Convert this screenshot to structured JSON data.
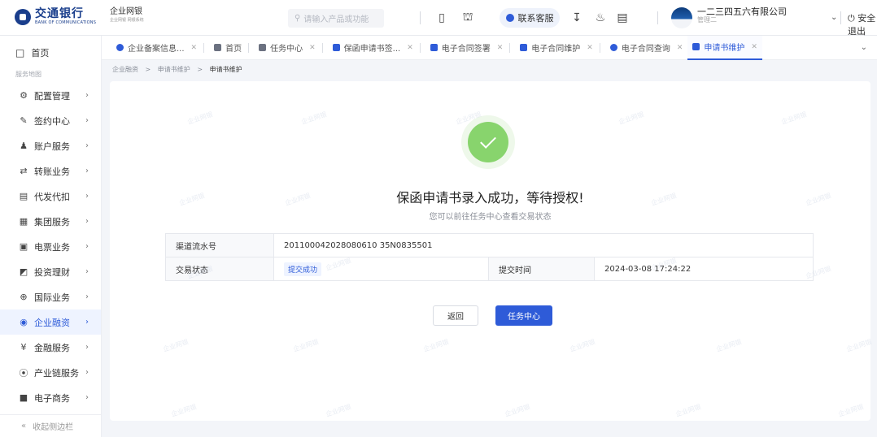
{
  "header": {
    "logo_cn": "交通银行",
    "logo_en": "BANK OF COMMUNICATIONS",
    "brand_cn": "企业网银",
    "brand_en": "企业网银 网银系统",
    "search_placeholder": "请输入产品或功能",
    "service_label": "联系客服",
    "company_name": "一二三四五六有限公司",
    "company_sub": "管理二",
    "logout_label": "安全退出"
  },
  "sidebar": {
    "home_label": "首页",
    "section_title": "服务地图",
    "items": [
      {
        "label": "配置管理",
        "icon": "settings-icon"
      },
      {
        "label": "签约中心",
        "icon": "pen-icon"
      },
      {
        "label": "账户服务",
        "icon": "user-icon"
      },
      {
        "label": "转账业务",
        "icon": "transfer-icon"
      },
      {
        "label": "代发代扣",
        "icon": "payroll-icon"
      },
      {
        "label": "集团服务",
        "icon": "group-icon"
      },
      {
        "label": "电票业务",
        "icon": "bill-icon"
      },
      {
        "label": "投资理财",
        "icon": "chart-icon"
      },
      {
        "label": "国际业务",
        "icon": "globe-icon"
      },
      {
        "label": "企业融资",
        "icon": "finance-icon"
      },
      {
        "label": "金融服务",
        "icon": "yuan-icon"
      },
      {
        "label": "产业链服务",
        "icon": "chain-icon"
      },
      {
        "label": "电子商务",
        "icon": "shop-icon"
      }
    ],
    "active_index": 9,
    "collapse_label": "收起侧边栏"
  },
  "tabs": [
    {
      "label": "企业备案信息...",
      "icon": "blue-round",
      "closable": true
    },
    {
      "label": "首页",
      "icon": "grey",
      "closable": false
    },
    {
      "label": "任务中心",
      "icon": "grey",
      "closable": true
    },
    {
      "label": "保函申请书签...",
      "icon": "blue",
      "closable": true
    },
    {
      "label": "电子合同签署",
      "icon": "blue",
      "closable": true
    },
    {
      "label": "电子合同维护",
      "icon": "blue",
      "closable": true
    },
    {
      "label": "电子合同查询",
      "icon": "blue-round",
      "closable": true
    },
    {
      "label": "申请书维护",
      "icon": "blue",
      "closable": true
    }
  ],
  "active_tab_index": 7,
  "breadcrumb": [
    "企业融资",
    "申请书维护",
    "申请书维护"
  ],
  "result": {
    "title": "保函申请书录入成功，等待授权!",
    "subtitle": "您可以前往任务中心查看交易状态",
    "serial_label": "渠道流水号",
    "serial_value": "201100042028080610 35N0835501",
    "status_label": "交易状态",
    "status_value": "提交成功",
    "time_label": "提交时间",
    "time_value": "2024-03-08 17:24:22"
  },
  "actions": {
    "back_label": "返回",
    "task_label": "任务中心"
  },
  "colors": {
    "primary": "#2e5bd8",
    "success": "#88d46d",
    "logo": "#1a3e8c"
  }
}
